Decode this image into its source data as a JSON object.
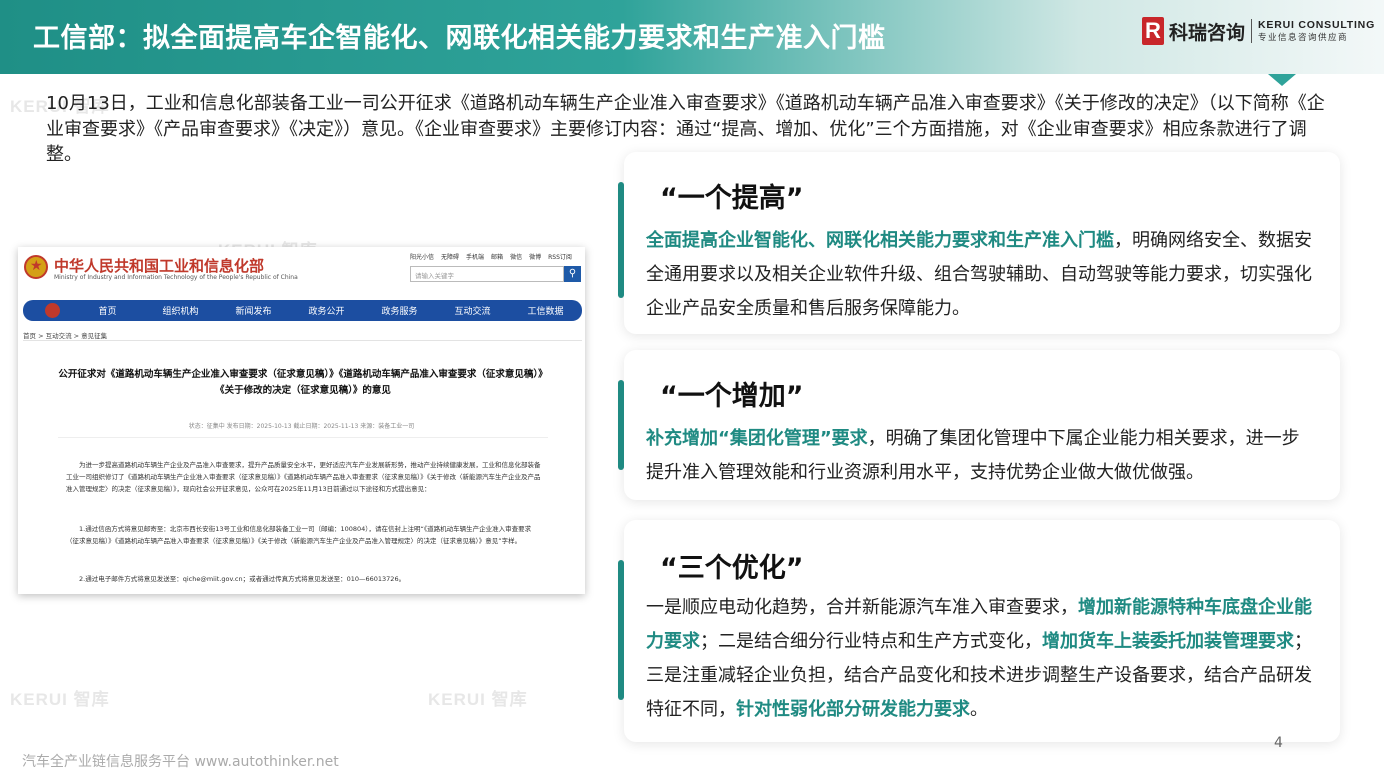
{
  "header": {
    "title": "工信部：拟全面提高车企智能化、网联化相关能力要求和生产准入门槛",
    "logo_mark": "R",
    "logo_cn": "科瑞咨询",
    "logo_en": "KERUI CONSULTING",
    "logo_sub": "专业信息咨询供应商"
  },
  "watermark": "KERUI 智库",
  "intro": "10月13日，工业和信息化部装备工业一司公开征求《道路机动车辆生产企业准入审查要求》《道路机动车辆产品准入审查要求》《关于修改的决定》（以下简称《企业审查要求》《产品审查要求》《决定》）意见。《企业审查要求》主要修订内容：通过“提高、增加、优化”三个方面措施，对《企业审查要求》相应条款进行了调整。",
  "screenshot": {
    "site_title": "中华人民共和国工业和信息化部",
    "site_title_en": "Ministry of Industry and Information Technology of the People's Republic of China",
    "top_links": [
      "阳光小信",
      "无障碍",
      "手机端",
      "邮箱",
      "微信",
      "微博",
      "RSS订阅"
    ],
    "search_placeholder": "请输入关键字",
    "nav": [
      "首页",
      "组织机构",
      "新闻发布",
      "政务公开",
      "政务服务",
      "互动交流",
      "工信数据"
    ],
    "breadcrumb": "首页  >  互动交流  >  意见征集",
    "heading": "公开征求对《道路机动车辆生产企业准入审查要求（征求意见稿）》《道路机动车辆产品准入审查要求（征求意见稿）》《关于修改的决定（征求意见稿）》的意见",
    "meta": "状态：征集中    发布日期：2025-10-13    截止日期：2025-11-13    来源：装备工业一司",
    "para1": "为进一步提高道路机动车辆生产企业及产品准入审查要求，提升产品质量安全水平，更好适应汽车产业发展新形势，推动产业持续健康发展，工业和信息化部装备工业一司组织修订了《道路机动车辆生产企业准入审查要求（征求意见稿）》《道路机动车辆产品准入审查要求（征求意见稿）》《关于修改〈新能源汽车生产企业及产品准入管理规定〉的决定（征求意见稿）》，现向社会公开征求意见，公众可在2025年11月13日前通过以下途径和方式提出意见：",
    "para2": "1.通过信函方式将意见邮寄至：北京市西长安街13号工业和信息化部装备工业一司（邮编：100804），请在信封上注明“《道路机动车辆生产企业准入审查要求（征求意见稿）》《道路机动车辆产品准入审查要求（征求意见稿）》《关于修改〈新能源汽车生产企业及产品准入管理规定〉的决定（征求意见稿）》意见”字样。",
    "para3": "2.通过电子邮件方式将意见发送至：qiche@miit.gov.cn；或者通过传真方式将意见发送至：010—66013726。"
  },
  "cards": [
    {
      "title": "“一个提高”",
      "hl1": "全面提高企业智能化、网联化相关能力要求和生产准入门槛",
      "text1": "，明确网络安全、数据安全通用要求以及相关企业软件升级、组合驾驶辅助、自动驾驶等能力要求，切实强化企业产品安全质量和售后服务保障能力。"
    },
    {
      "title": "“一个增加”",
      "hl1": "补充增加“集团化管理”要求",
      "text1": "，明确了集团化管理中下属企业能力相关要求，进一步提升准入管理效能和行业资源利用水平，支持优势企业做大做优做强。"
    },
    {
      "title": "“三个优化”",
      "text0": "一是顺应电动化趋势，合并新能源汽车准入审查要求，",
      "hl1": "增加新能源特种车底盘企业能力要求",
      "text1": "；二是结合细分行业特点和生产方式变化，",
      "hl2": "增加货车上装委托加装管理要求",
      "text2": "；三是注重减轻企业负担，结合产品变化和技术进步调整生产设备要求，结合产品研发特征不同，",
      "hl3": "针对性弱化部分研发能力要求",
      "text3": "。"
    }
  ],
  "footer": "汽车全产业链信息服务平台 www.autothinker.net",
  "page_number": "4"
}
